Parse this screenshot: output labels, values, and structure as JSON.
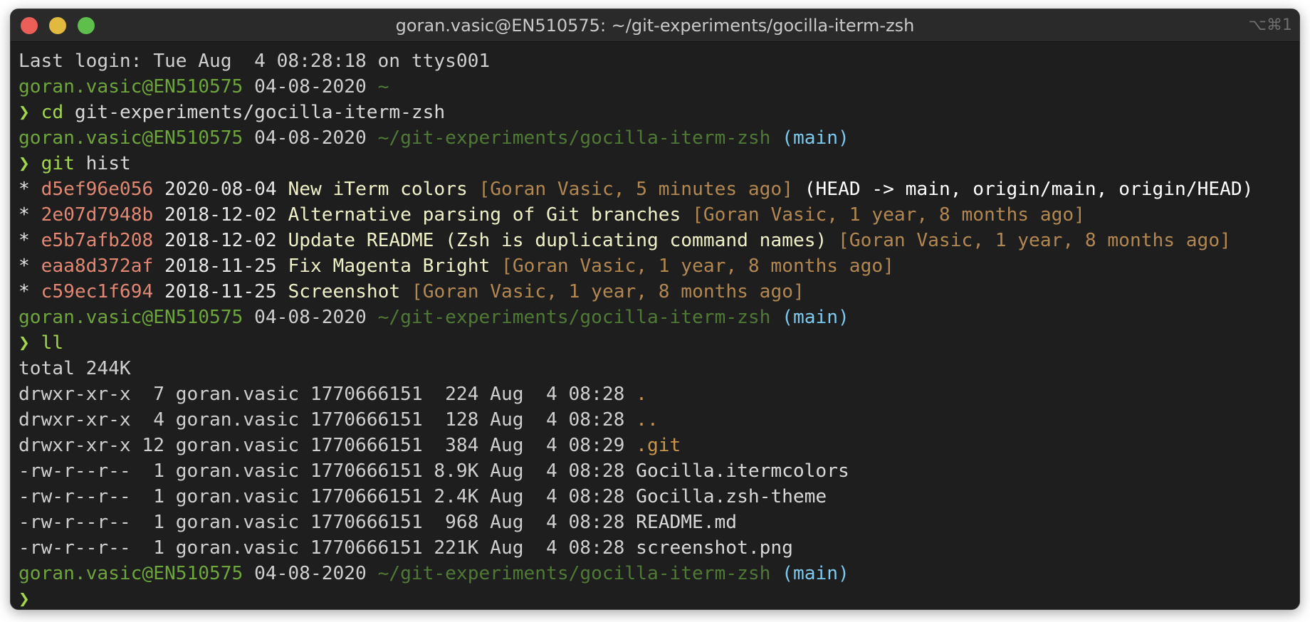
{
  "window": {
    "title": "goran.vasic@EN510575: ~/git-experiments/gocilla-iterm-zsh",
    "shortcut": "⌥⌘1"
  },
  "colors": {
    "background": "#1e1e1e",
    "host": "#6ea53c",
    "path": "#4f7a36",
    "branch": "#7ec9ef",
    "prompt_arrow": "#a3d64c",
    "commit_hash": "#e28774",
    "commit_author": "#b28751",
    "directory": "#c9954c"
  },
  "terminal": {
    "last_login": "Last login: Tue Aug  4 08:28:18 on ttys001",
    "prompts": [
      {
        "host": "goran.vasic@EN510575",
        "date": "04-08-2020",
        "path": "~",
        "branch": ""
      },
      {
        "host": "goran.vasic@EN510575",
        "date": "04-08-2020",
        "path": "~/git-experiments/gocilla-iterm-zsh",
        "branch": "(main)"
      },
      {
        "host": "goran.vasic@EN510575",
        "date": "04-08-2020",
        "path": "~/git-experiments/gocilla-iterm-zsh",
        "branch": "(main)"
      },
      {
        "host": "goran.vasic@EN510575",
        "date": "04-08-2020",
        "path": "~/git-experiments/gocilla-iterm-zsh",
        "branch": "(main)"
      }
    ],
    "prompt_symbol": "❯",
    "commands": [
      {
        "name": "cd",
        "args": "git-experiments/gocilla-iterm-zsh"
      },
      {
        "name": "git",
        "args": "hist"
      },
      {
        "name": "ll",
        "args": ""
      }
    ],
    "git_log": [
      {
        "star": "*",
        "hash": "d5ef96e056",
        "date": "2020-08-04",
        "message": "New iTerm colors",
        "author": "[Goran Vasic, 5 minutes ago]",
        "refs": "(HEAD -> main, origin/main, origin/HEAD)"
      },
      {
        "star": "*",
        "hash": "2e07d7948b",
        "date": "2018-12-02",
        "message": "Alternative parsing of Git branches",
        "author": "[Goran Vasic, 1 year, 8 months ago]",
        "refs": ""
      },
      {
        "star": "*",
        "hash": "e5b7afb208",
        "date": "2018-12-02",
        "message": "Update README (Zsh is duplicating command names)",
        "author": "[Goran Vasic, 1 year, 8 months ago]",
        "refs": ""
      },
      {
        "star": "*",
        "hash": "eaa8d372af",
        "date": "2018-11-25",
        "message": "Fix Magenta Bright",
        "author": "[Goran Vasic, 1 year, 8 months ago]",
        "refs": ""
      },
      {
        "star": "*",
        "hash": "c59ec1f694",
        "date": "2018-11-25",
        "message": "Screenshot",
        "author": "[Goran Vasic, 1 year, 8 months ago]",
        "refs": ""
      }
    ],
    "ll_total": "total 244K",
    "ll_rows": [
      {
        "meta": "drwxr-xr-x  7 goran.vasic 1770666151  224 Aug  4 08:28",
        "name": ".",
        "is_dir": true
      },
      {
        "meta": "drwxr-xr-x  4 goran.vasic 1770666151  128 Aug  4 08:28",
        "name": "..",
        "is_dir": true
      },
      {
        "meta": "drwxr-xr-x 12 goran.vasic 1770666151  384 Aug  4 08:29",
        "name": ".git",
        "is_dir": true
      },
      {
        "meta": "-rw-r--r--  1 goran.vasic 1770666151 8.9K Aug  4 08:28",
        "name": "Gocilla.itermcolors",
        "is_dir": false
      },
      {
        "meta": "-rw-r--r--  1 goran.vasic 1770666151 2.4K Aug  4 08:28",
        "name": "Gocilla.zsh-theme",
        "is_dir": false
      },
      {
        "meta": "-rw-r--r--  1 goran.vasic 1770666151  968 Aug  4 08:28",
        "name": "README.md",
        "is_dir": false
      },
      {
        "meta": "-rw-r--r--  1 goran.vasic 1770666151 221K Aug  4 08:28",
        "name": "screenshot.png",
        "is_dir": false
      }
    ]
  }
}
